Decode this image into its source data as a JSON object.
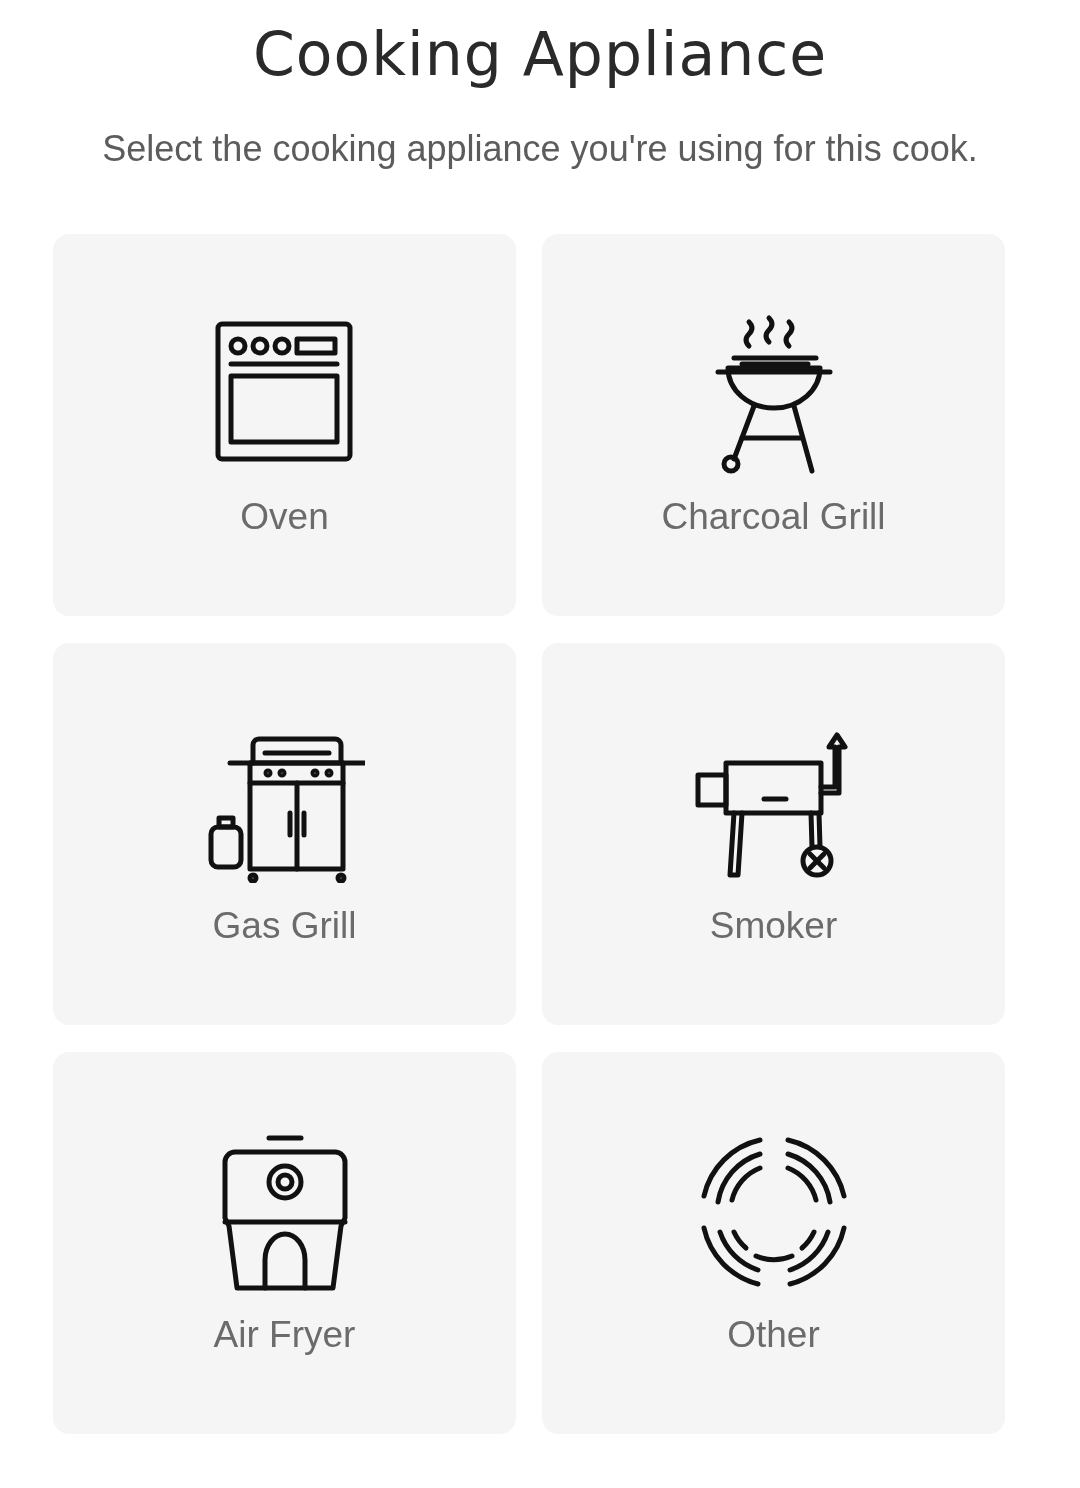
{
  "title": "Cooking Appliance",
  "subtitle": "Select the cooking appliance you're using for this cook.",
  "appliances": [
    {
      "label": "Oven",
      "kind": "oven"
    },
    {
      "label": "Charcoal Grill",
      "kind": "charcoal-grill"
    },
    {
      "label": "Gas Grill",
      "kind": "gas-grill"
    },
    {
      "label": "Smoker",
      "kind": "smoker"
    },
    {
      "label": "Air Fryer",
      "kind": "air-fryer"
    },
    {
      "label": "Other",
      "kind": "other"
    }
  ]
}
